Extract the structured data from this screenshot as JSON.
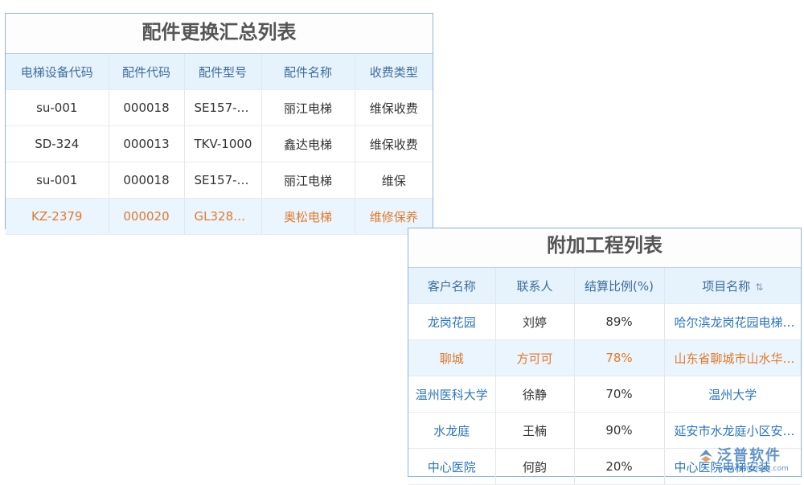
{
  "replacement": {
    "title": "配件更换汇总列表",
    "headers": [
      "电梯设备代码",
      "配件代码",
      "配件型号",
      "配件名称",
      "收费类型"
    ],
    "rows": [
      [
        "su-001",
        "000018",
        "SE157-…",
        "丽江电梯",
        "维保收费"
      ],
      [
        "SD-324",
        "000013",
        "TKV-1000",
        "鑫达电梯",
        "维保收费"
      ],
      [
        "su-001",
        "000018",
        "SE157-…",
        "丽江电梯",
        "维保"
      ],
      [
        "KZ-2379",
        "000020",
        "GL328…",
        "奥松电梯",
        "维修保养"
      ]
    ]
  },
  "extra": {
    "title": "附加工程列表",
    "headers": [
      "客户名称",
      "联系人",
      "结算比例(%)",
      "项目名称"
    ],
    "rows": [
      [
        "龙岗花园",
        "刘婷",
        "89%",
        "哈尔滨龙岗花园电梯…"
      ],
      [
        "聊城",
        "方可可",
        "78%",
        "山东省聊城市山水华…"
      ],
      [
        "温州医科大学",
        "徐静",
        "70%",
        "温州大学"
      ],
      [
        "水龙庭",
        "王楠",
        "90%",
        "延安市水龙庭小区安…"
      ],
      [
        "中心医院",
        "何韵",
        "20%",
        "中心医院电梯安装"
      ]
    ]
  },
  "watermark": {
    "brand": "泛普软件",
    "url": "www.fanpusoft.com"
  },
  "colors": {
    "header_bg": "#e6f2fc",
    "highlight_row_bg": "#eaf5fd",
    "highlight_text": "#e07a2d",
    "link": "#2a74c0"
  },
  "icons": {
    "sort": "sort-icon"
  }
}
